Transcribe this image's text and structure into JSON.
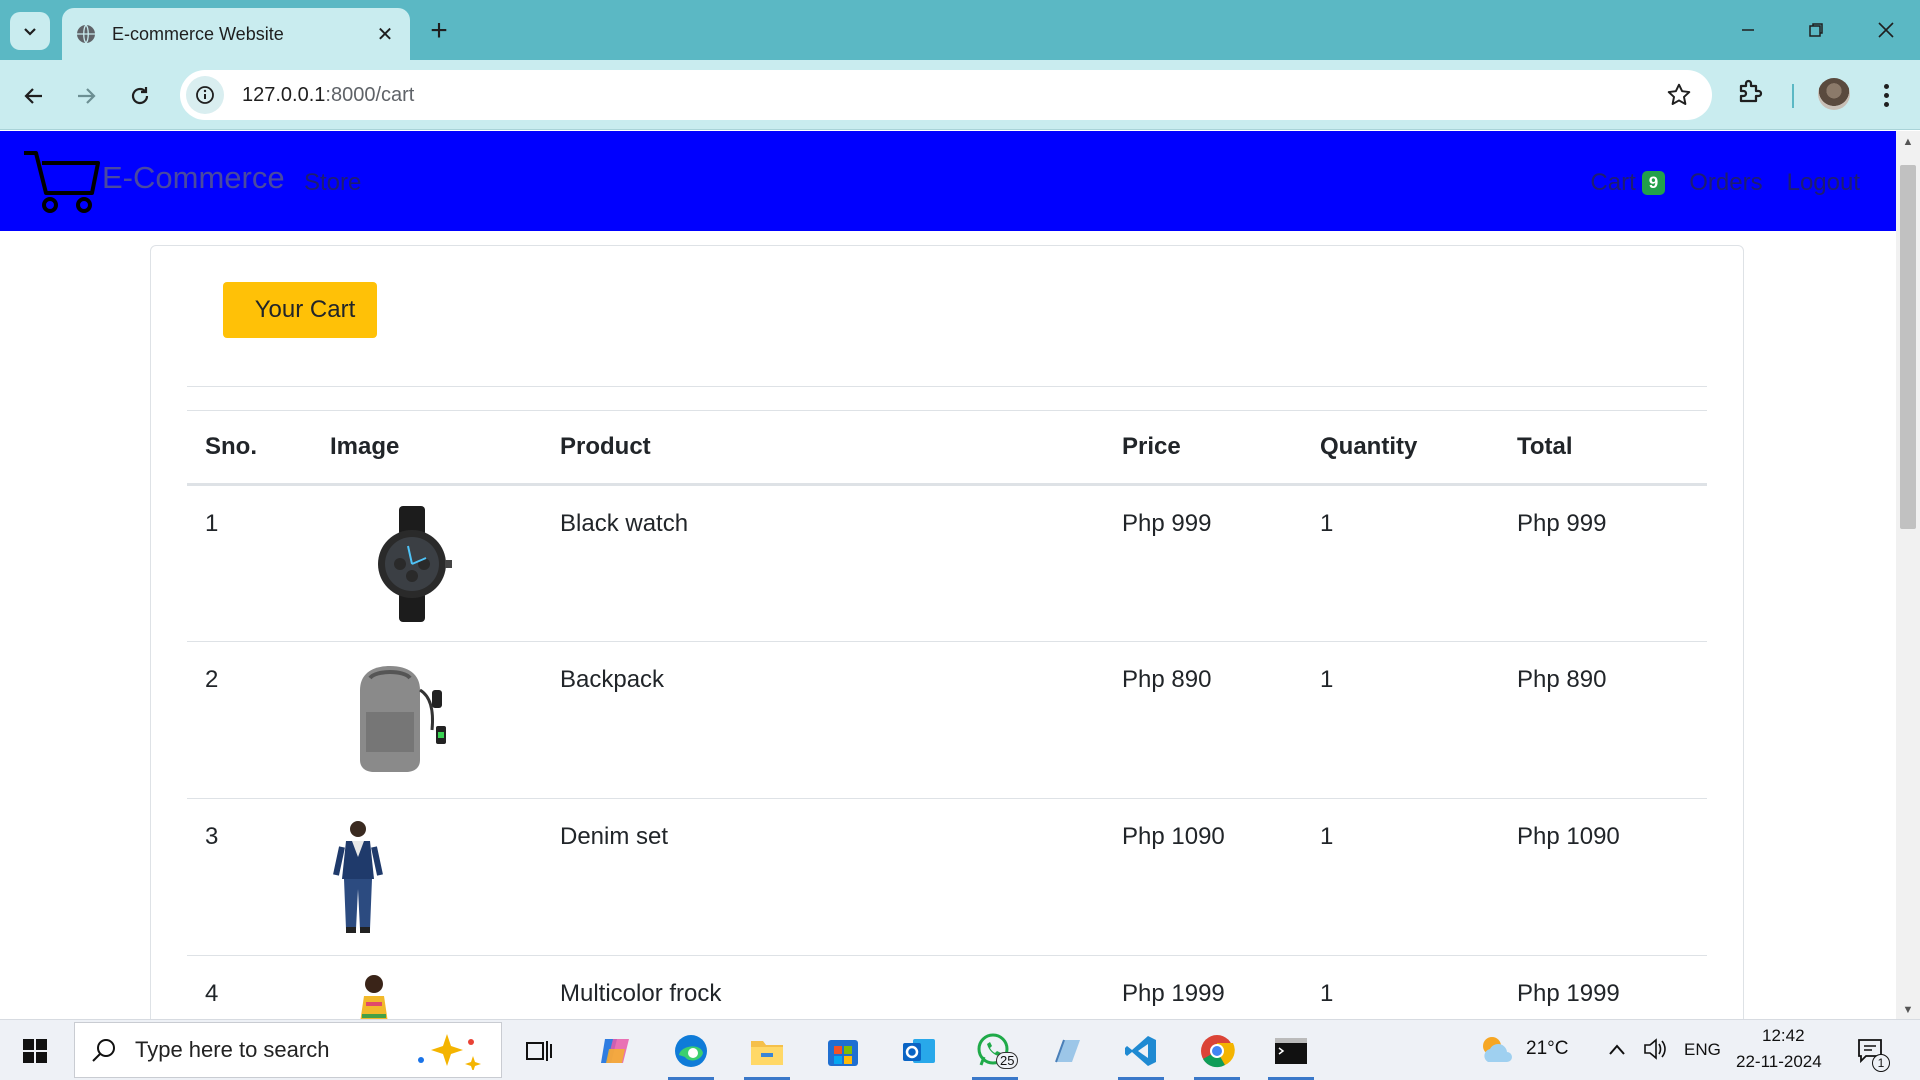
{
  "browser": {
    "tab_title": "E-commerce Website",
    "url_host": "127.0.0.1",
    "url_path": ":8000/cart"
  },
  "site": {
    "brand": "E-Commerce",
    "nav_store": "Store",
    "nav_cart": "Cart",
    "cart_count": "9",
    "nav_orders": "Orders",
    "nav_logout": "Logout"
  },
  "cart": {
    "heading_button": "Your Cart",
    "columns": [
      "Sno.",
      "Image",
      "Product",
      "Price",
      "Quantity",
      "Total"
    ],
    "rows": [
      {
        "sno": "1",
        "image": "black-watch-image",
        "product": "Black watch",
        "price": "Php 999",
        "quantity": "1",
        "total": "Php 999"
      },
      {
        "sno": "2",
        "image": "backpack-image",
        "product": "Backpack",
        "price": "Php 890",
        "quantity": "1",
        "total": "Php 890"
      },
      {
        "sno": "3",
        "image": "denim-set-image",
        "product": "Denim set",
        "price": "Php 1090",
        "quantity": "1",
        "total": "Php 1090"
      },
      {
        "sno": "4",
        "image": "multicolor-frock-image",
        "product": "Multicolor frock",
        "price": "Php 1999",
        "quantity": "1",
        "total": "Php 1999"
      }
    ]
  },
  "taskbar": {
    "search_placeholder": "Type here to search",
    "whatsapp_badge": "25",
    "weather": "21°C",
    "language": "ENG",
    "time": "12:42",
    "date": "22-11-2024",
    "notifications": "1"
  },
  "colors": {
    "navbar": "#0000ff",
    "cart_badge": "#22a04b",
    "your_cart_button": "#ffc107",
    "browser_frame": "#5bb8c4"
  }
}
